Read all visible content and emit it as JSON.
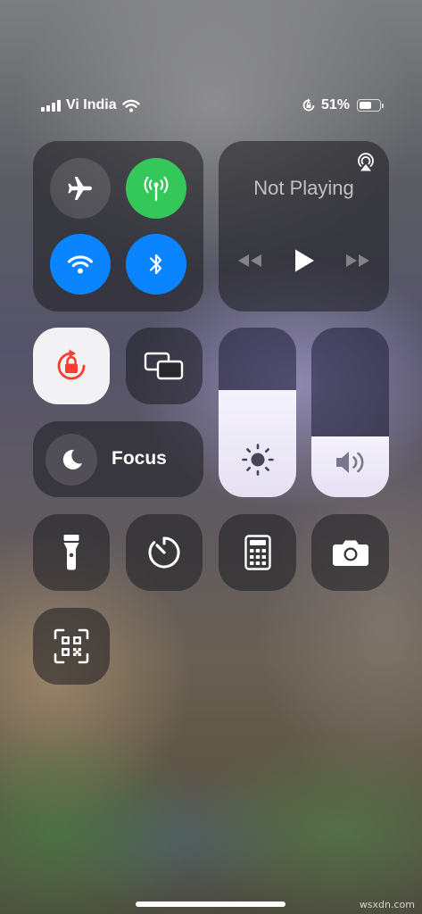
{
  "status_bar": {
    "carrier": "Vi India",
    "battery_percent_label": "51%",
    "battery_level": 0.51,
    "icons": [
      "signal-bars-icon",
      "wifi-icon",
      "rotation-lock-icon",
      "battery-icon"
    ]
  },
  "connectivity": {
    "airplane": {
      "icon": "airplane-icon",
      "active": false
    },
    "cellular": {
      "icon": "cellular-antenna-icon",
      "active": true,
      "color": "#34c759"
    },
    "wifi": {
      "icon": "wifi-icon",
      "active": true,
      "color": "#0a84ff"
    },
    "bluetooth": {
      "icon": "bluetooth-icon",
      "active": true,
      "color": "#0a84ff"
    }
  },
  "media": {
    "title": "Not Playing",
    "icons": [
      "airplay-icon",
      "rewind-icon",
      "play-icon",
      "fast-forward-icon"
    ]
  },
  "toggles": {
    "orientation_lock": {
      "icon": "orientation-lock-icon",
      "active": true,
      "color": "#ff3b30"
    },
    "screen_mirroring": {
      "icon": "screen-mirroring-icon"
    }
  },
  "focus": {
    "label": "Focus",
    "icon": "moon-icon"
  },
  "brightness": {
    "icon": "sun-icon",
    "level": 0.63
  },
  "volume": {
    "icon": "speaker-icon",
    "level": 0.36
  },
  "shortcuts": [
    {
      "name": "flashlight",
      "icon": "flashlight-icon"
    },
    {
      "name": "timer",
      "icon": "timer-icon"
    },
    {
      "name": "calculator",
      "icon": "calculator-icon"
    },
    {
      "name": "camera",
      "icon": "camera-icon"
    },
    {
      "name": "code-scanner",
      "icon": "qr-code-icon"
    }
  ],
  "watermark": "wsxdn.com",
  "colors": {
    "green": "#34c759",
    "blue": "#0a84ff",
    "red": "#ff3b30",
    "tile": "rgba(28,28,33,0.55)"
  }
}
